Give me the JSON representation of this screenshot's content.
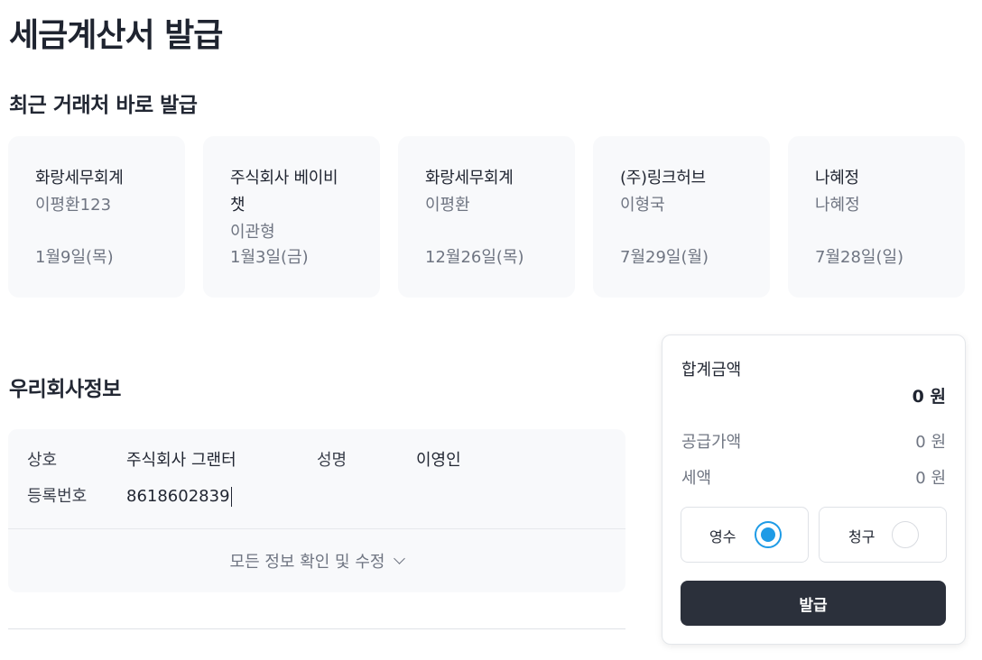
{
  "page_title": "세금계산서 발급",
  "recent": {
    "title": "최근 거래처 바로 발급",
    "cards": [
      {
        "company": "화랑세무회계",
        "person": "이평환123",
        "date": "1월9일(목)"
      },
      {
        "company": "주식회사 베이비챗",
        "person": "이관형",
        "date": "1월3일(금)"
      },
      {
        "company": "화랑세무회계",
        "person": "이평환",
        "date": "12월26일(목)"
      },
      {
        "company": "(주)링크허브",
        "person": "이형국",
        "date": "7월29일(월)"
      },
      {
        "company": "나혜정",
        "person": "나혜정",
        "date": "7월28일(일)"
      }
    ]
  },
  "company_info": {
    "title": "우리회사정보",
    "name_label": "상호",
    "name_value": "주식회사 그랜터",
    "ceo_label": "성명",
    "ceo_value": "이영인",
    "reg_label": "등록번호",
    "reg_value": "8618602839",
    "expand_label": "모든 정보 확인 및 수정"
  },
  "summary": {
    "total_label": "합계금액",
    "total_value": "0 원",
    "supply_label": "공급가액",
    "supply_value": "0 원",
    "tax_label": "세액",
    "tax_value": "0 원",
    "option_receipt": "영수",
    "option_claim": "청구",
    "selected_option": "영수",
    "issue_button": "발급"
  },
  "colors": {
    "accent": "#1e9be6",
    "button_dark": "#2b303b",
    "card_bg": "#f8f9fb"
  },
  "icons": {
    "expand": "chevron-down-icon"
  }
}
